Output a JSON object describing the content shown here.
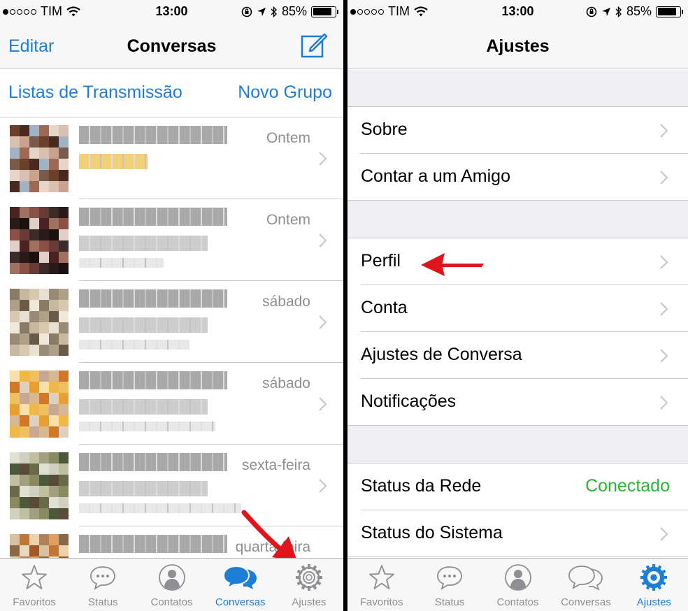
{
  "status_bar": {
    "carrier": "TIM",
    "time": "13:00",
    "battery_percent": "85%",
    "battery_level": 0.85
  },
  "left_screen": {
    "nav": {
      "edit_label": "Editar",
      "title": "Conversas",
      "compose_icon": "compose-icon"
    },
    "broadcast_label": "Listas de Transmissão",
    "new_group_label": "Novo Grupo",
    "chats": [
      {
        "time": "Ontem"
      },
      {
        "time": "Ontem"
      },
      {
        "time": "sábado"
      },
      {
        "time": "sábado"
      },
      {
        "time": "sexta-feira"
      },
      {
        "time": "quarta-feira"
      }
    ]
  },
  "right_screen": {
    "nav": {
      "title": "Ajustes"
    },
    "groups": [
      [
        {
          "label": "Sobre"
        },
        {
          "label": "Contar a um Amigo"
        }
      ],
      [
        {
          "label": "Perfil"
        },
        {
          "label": "Conta"
        },
        {
          "label": "Ajustes de Conversa"
        },
        {
          "label": "Notificações"
        }
      ],
      [
        {
          "label": "Status da Rede",
          "value": "Conectado"
        },
        {
          "label": "Status do Sistema"
        }
      ]
    ]
  },
  "tab_bar": {
    "tabs": [
      {
        "label": "Favoritos",
        "icon": "star-icon"
      },
      {
        "label": "Status",
        "icon": "speech-bubble-icon"
      },
      {
        "label": "Contatos",
        "icon": "person-icon"
      },
      {
        "label": "Conversas",
        "icon": "chat-bubbles-icon"
      },
      {
        "label": "Ajustes",
        "icon": "gear-icon"
      }
    ]
  },
  "colors": {
    "accent": "#1e7dd4",
    "connected": "#2fb335",
    "annotation_arrow": "#e0141a"
  }
}
